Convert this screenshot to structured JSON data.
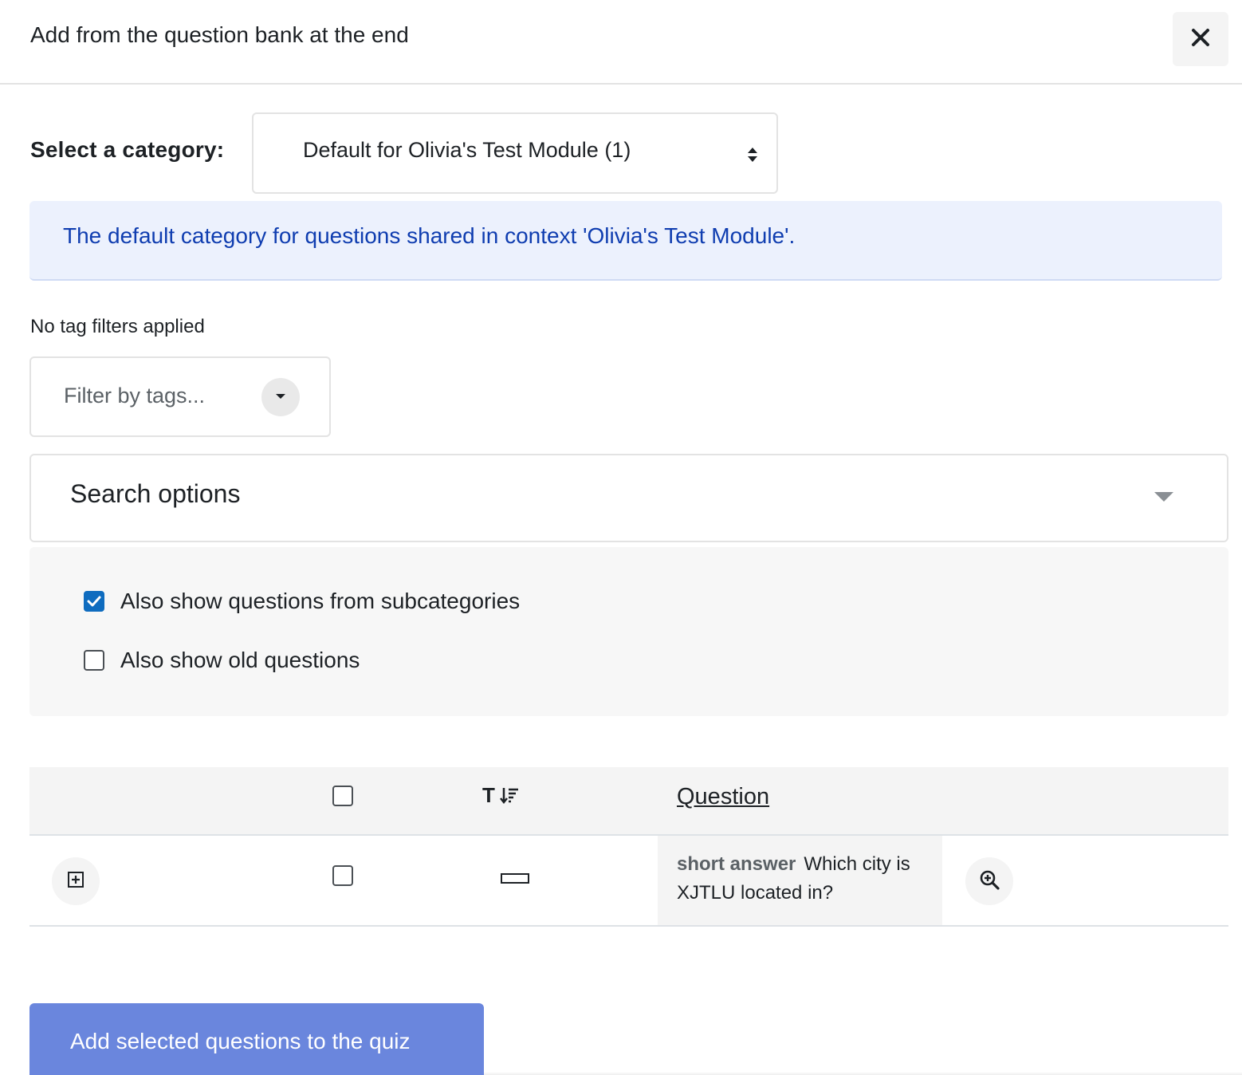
{
  "modal": {
    "title": "Add from the question bank at the end",
    "close_icon": "close-icon"
  },
  "category": {
    "label": "Select a category:",
    "selected": "Default for Olivia's Test Module (1)"
  },
  "info": {
    "text": "The default category for questions shared in context 'Olivia's Test Module'."
  },
  "tags": {
    "status": "No tag filters applied",
    "placeholder": "Filter by tags..."
  },
  "search_options": {
    "title": "Search options",
    "subcategories_label": "Also show questions from subcategories",
    "subcategories_checked": true,
    "old_questions_label": "Also show old questions",
    "old_questions_checked": false
  },
  "table": {
    "headers": {
      "type": "T",
      "question": "Question"
    },
    "rows": [
      {
        "type_name": "short answer",
        "question_text": "Which city is XJTLU located in?",
        "selected": false
      }
    ]
  },
  "footer": {
    "submit_label": "Add selected questions to the quiz"
  },
  "colors": {
    "primary": "#0f6cbf",
    "submit_button": "#6a86dd",
    "info_text": "#0f3db0",
    "info_background": "#ecf1fd"
  }
}
